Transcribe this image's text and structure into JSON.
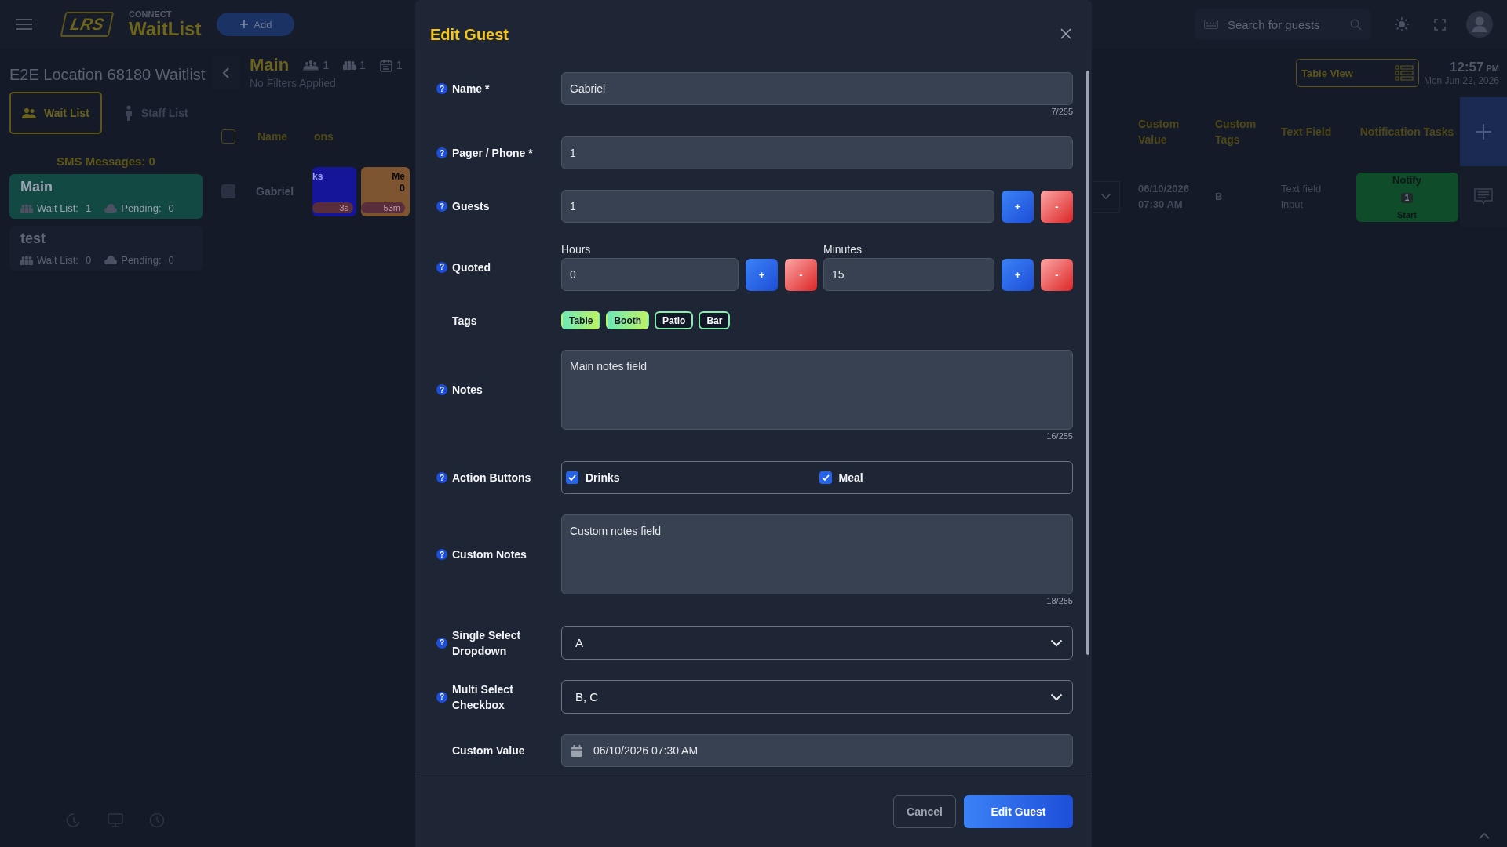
{
  "top_bar": {
    "logo": "LRS",
    "brand_small": "CONNECT",
    "brand": "WaitList",
    "add_button": "Add",
    "search": {
      "placeholder": "Search for guests"
    }
  },
  "sidebar": {
    "location_title": "E2E Location 68180 Waitlist",
    "tabs": [
      {
        "label": "Wait List",
        "selected": true
      },
      {
        "label": "Staff List",
        "selected": false
      }
    ],
    "sms": "SMS Messages: 0",
    "lists": [
      {
        "name": "Main",
        "selected": true,
        "wait_label": "Wait List:",
        "wait_count": "1",
        "pending_label": "Pending:",
        "pending_count": "0"
      },
      {
        "name": "test",
        "selected": false,
        "wait_label": "Wait List:",
        "wait_count": "0",
        "pending_label": "Pending:",
        "pending_count": "0"
      }
    ]
  },
  "list_header": {
    "title": "Main",
    "stats": [
      "1",
      "1",
      "1"
    ],
    "filters": "No Filters Applied"
  },
  "view_toggle": "Table View",
  "clock": {
    "time": "12:57",
    "period": "PM",
    "date": "Mon Jun 22, 2026"
  },
  "table": {
    "select_all": {
      "checked": false
    },
    "columns": [
      "Name",
      "ons",
      "Custom Value",
      "Custom Tags",
      "Text Field",
      "Notification Tasks"
    ],
    "rows": [
      {
        "checked": false,
        "name": "Gabriel",
        "action_tiles": [
          {
            "label": "ks",
            "timer": "3s",
            "color": "#15159a"
          },
          {
            "label": "Me",
            "count": "0",
            "timer": "53m",
            "color": "#7d5530"
          }
        ],
        "custom_value": "06/10/2026 07:30 AM",
        "custom_tags": "B",
        "text_field": "Text field input",
        "notify": {
          "label": "Notify",
          "count": "1",
          "action": "Start"
        }
      }
    ]
  },
  "modal": {
    "title": "Edit Guest",
    "fields": [
      {
        "kind": "text",
        "help": "?",
        "label": "Name *",
        "value": "Gabriel",
        "counter": "7/255"
      },
      {
        "kind": "text",
        "help": "?",
        "label": "Pager / Phone *",
        "value": "1"
      },
      {
        "kind": "stepper",
        "help": "?",
        "label": "Guests",
        "value": "1",
        "plus": "+",
        "minus": "-"
      },
      {
        "kind": "quoted",
        "help": "?",
        "label": "Quoted",
        "parts": [
          {
            "label": "Hours",
            "value": "0",
            "plus": "+",
            "minus": "-"
          },
          {
            "label": "Minutes",
            "value": "15",
            "plus": "+",
            "minus": "-"
          }
        ]
      },
      {
        "kind": "tags",
        "label": "Tags",
        "tags": [
          {
            "label": "Table",
            "selected": true
          },
          {
            "label": "Booth",
            "selected": true
          },
          {
            "label": "Patio",
            "selected": false
          },
          {
            "label": "Bar",
            "selected": false
          }
        ]
      },
      {
        "kind": "textarea",
        "help": "?",
        "label": "Notes",
        "value": "Main notes field",
        "counter": "16/255"
      },
      {
        "kind": "checkboxes",
        "help": "?",
        "label": "Action Buttons",
        "options": [
          {
            "label": "Drinks",
            "checked": true
          },
          {
            "label": "Meal",
            "checked": true
          }
        ]
      },
      {
        "kind": "textarea",
        "help": "?",
        "label": "Custom Notes",
        "value": "Custom notes field",
        "counter": "18/255"
      },
      {
        "kind": "select",
        "help": "?",
        "label": "Single Select Dropdown",
        "value": "A"
      },
      {
        "kind": "select",
        "help": "?",
        "label": "Multi Select Checkbox",
        "value": "B, C"
      },
      {
        "kind": "date",
        "label": "Custom Value",
        "value": "06/10/2026 07:30 AM"
      }
    ],
    "buttons": [
      {
        "label": "Cancel",
        "kind": "secondary"
      },
      {
        "label": "Edit Guest",
        "kind": "primary"
      }
    ]
  }
}
